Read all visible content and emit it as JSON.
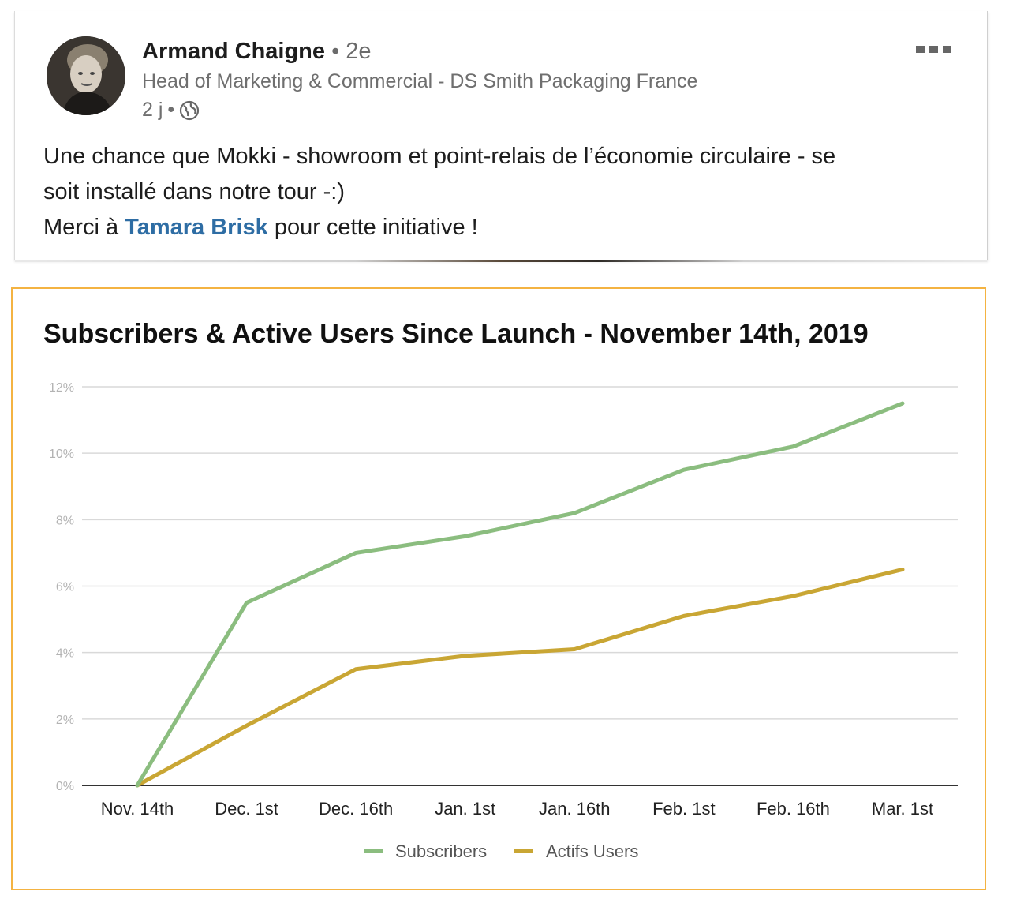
{
  "post": {
    "author_name": "Armand Chaigne",
    "degree": "• 2e",
    "headline": "Head of Marketing & Commercial - DS Smith Packaging France",
    "time": "2 j",
    "time_sep": "•",
    "visibility_icon": "globe-icon",
    "more_icon": "more-dots-icon",
    "text_line1": "Une chance que Mokki - showroom et point-relais de l’économie circulaire - se",
    "text_line2": "soit installé dans notre tour -:)",
    "text_line3_prefix": "Merci à ",
    "mention": "Tamara Brisk",
    "text_line3_suffix": " pour cette initiative !"
  },
  "colors": {
    "subscribers": "#8bbd7f",
    "actifs": "#c9a634",
    "chart_border": "#f4b342",
    "mention": "#2e6da4"
  },
  "chart_data": {
    "type": "line",
    "title": "Subscribers & Active Users Since Launch - November 14th, 2019",
    "categories": [
      "Nov. 14th",
      "Dec. 1st",
      "Dec. 16th",
      "Jan. 1st",
      "Jan. 16th",
      "Feb. 1st",
      "Feb. 16th",
      "Mar. 1st"
    ],
    "y_ticks": [
      "0%",
      "2%",
      "4%",
      "6%",
      "8%",
      "10%",
      "12%"
    ],
    "ylim": [
      0,
      12
    ],
    "grid": true,
    "legend_position": "bottom",
    "series": [
      {
        "name": "Subscribers",
        "values": [
          0,
          5.5,
          7.0,
          7.5,
          8.2,
          9.5,
          10.2,
          11.5
        ]
      },
      {
        "name": "Actifs Users",
        "values": [
          0,
          1.8,
          3.5,
          3.9,
          4.1,
          5.1,
          5.7,
          6.5
        ]
      }
    ]
  }
}
